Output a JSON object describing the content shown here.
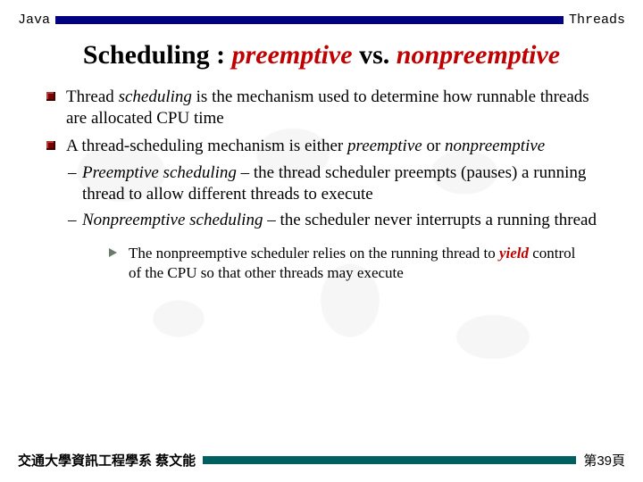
{
  "header": {
    "left": "Java",
    "right": "Threads"
  },
  "title": {
    "prefix": "Scheduling : ",
    "em1": "preemptive",
    "mid": " vs. ",
    "em2": "nonpreemptive"
  },
  "bullets": [
    {
      "parts": [
        {
          "t": "Thread "
        },
        {
          "t": "scheduling",
          "i": true
        },
        {
          "t": " is the mechanism used to determine how runnable threads are allocated CPU time"
        }
      ]
    },
    {
      "parts": [
        {
          "t": "A thread-scheduling mechanism is either "
        },
        {
          "t": "preemptive",
          "i": true
        },
        {
          "t": " or "
        },
        {
          "t": "nonpreemptive",
          "i": true
        }
      ],
      "subs": [
        {
          "parts": [
            {
              "t": "Preemptive scheduling",
              "i": true
            },
            {
              "t": " – the thread scheduler preempts (pauses) a running thread to allow different threads to execute"
            }
          ]
        },
        {
          "parts": [
            {
              "t": "Nonpreemptive scheduling",
              "i": true
            },
            {
              "t": " – the scheduler never interrupts a running thread"
            }
          ]
        }
      ]
    }
  ],
  "tri": {
    "parts": [
      {
        "t": "The nonpreemptive scheduler relies on the running thread to "
      },
      {
        "t": "yield",
        "r": true
      },
      {
        "t": " control of the CPU so that other threads may execute"
      }
    ]
  },
  "footer": {
    "left": "交通大學資訊工程學系 蔡文能",
    "right": "第39頁"
  }
}
